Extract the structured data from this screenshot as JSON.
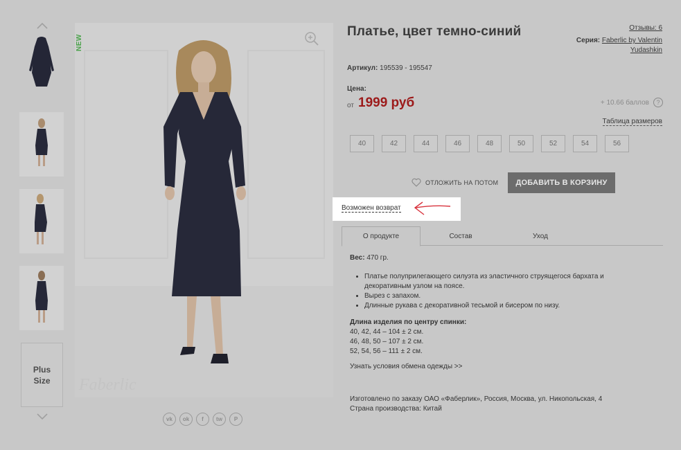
{
  "product": {
    "title": "Платье, цвет темно-синий",
    "reviews": "Отзывы: 6",
    "series_label": "Серия:",
    "series_value": "Faberlic by Valentin Yudashkin",
    "article_label": "Артикул:",
    "article_value": "195539 - 195547",
    "price_label": "Цена:",
    "price_from": "от",
    "price": "1999 руб",
    "points": "+ 10.66 баллов",
    "help_icon": "?",
    "size_table": "Таблица размеров",
    "new_badge": "NEW"
  },
  "sizes": [
    "40",
    "42",
    "44",
    "46",
    "48",
    "50",
    "52",
    "54",
    "56"
  ],
  "actions": {
    "later": "ОТЛОЖИТЬ НА ПОТОМ",
    "add_to_cart": "ДОБАВИТЬ В КОРЗИНУ",
    "return": "Возможен возврат"
  },
  "tabs": [
    "О продукте",
    "Состав",
    "Уход"
  ],
  "details": {
    "weight_label": "Вес:",
    "weight_value": "470 гр.",
    "bullets": [
      "Платье полуприлегающего силуэта из эластичного струящегося бархата и декоративным узлом на поясе.",
      "Вырез с запахом.",
      "Длинные рукава с декоративной тесьмой и бисером по низу."
    ],
    "length_title": "Длина изделия по центру спинки:",
    "length_lines": [
      "40, 42, 44 – 104 ± 2 см.",
      "46, 48, 50 – 107 ± 2 см.",
      "52, 54, 56 – 111 ± 2 см."
    ],
    "exchange_link": "Узнать условия обмена одежды >>",
    "made_by": "Изготовлено по заказу ОАО «Фаберлик», Россия, Москва, ул. Никопольская, 4",
    "country": "Страна производства: Китай"
  },
  "thumbnails": {
    "plus_size_line1": "Plus",
    "plus_size_line2": "Size"
  },
  "share": [
    "vk",
    "ok",
    "f",
    "tw",
    "P"
  ],
  "icons": {
    "arrow_up": "chevron-up-icon",
    "arrow_down": "chevron-down-icon",
    "zoom": "zoom-in-icon",
    "heart": "heart-icon"
  },
  "colors": {
    "price": "#9c1a1a",
    "new_badge": "#4aa24a",
    "cart_button": "#6c6c6c",
    "annotation_arrow": "#d8323c",
    "overlay": "#c8c8c8"
  }
}
